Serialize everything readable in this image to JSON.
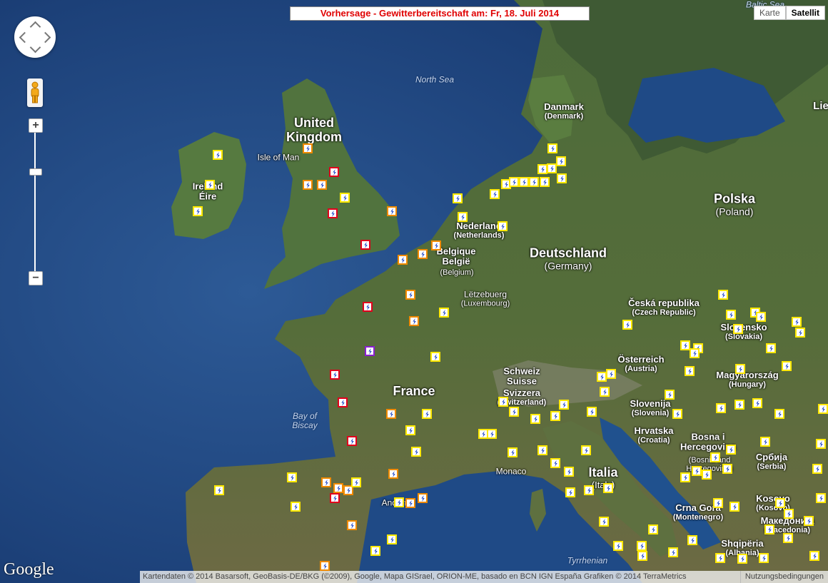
{
  "title": "Vorhersage - Gewitterbereitschaft am: Fr, 18. Juli 2014",
  "map_type": {
    "map": "Karte",
    "satellite": "Satellit",
    "active": "satellite"
  },
  "zoom": {
    "plus": "+",
    "minus": "−",
    "level_fraction": 0.72
  },
  "attribution": "Kartendaten © 2014 Basarsoft, GeoBasis-DE/BKG (©2009), Google, Mapa GISrael, ORION-ME, basado en BCN IGN España Grafiken © 2014 TerraMetrics",
  "terms": "Nutzungsbedingungen",
  "logo": "Google",
  "colors": {
    "yellow": "#ffe800",
    "orange": "#f08a00",
    "red": "#e0001c",
    "purple": "#8a1fd0",
    "title_text": "#e00000"
  },
  "countries": [
    {
      "name": "United Kingdom"
    },
    {
      "name": "Ireland",
      "sub": "Éire"
    },
    {
      "name": "Danmark",
      "sub": "(Denmark)"
    },
    {
      "name": "Polska",
      "sub": "(Poland)"
    },
    {
      "name": "Deutschland",
      "sub": "(Germany)"
    },
    {
      "name": "Nederland",
      "sub": "(Netherlands)"
    },
    {
      "name": "Belgique",
      "sub": "België"
    },
    {
      "name": "(Belgium)"
    },
    {
      "name": "Lëtzebuerg",
      "sub": "(Luxembourg)"
    },
    {
      "name": "France"
    },
    {
      "name": "Schweiz",
      "sub": "Suisse"
    },
    {
      "name": "Svizzera",
      "sub": "(Switzerland)"
    },
    {
      "name": "Česká republika",
      "sub": "(Czech Republic)"
    },
    {
      "name": "Slovensko",
      "sub": "(Slovakia)"
    },
    {
      "name": "Österreich",
      "sub": "(Austria)"
    },
    {
      "name": "Magyarország",
      "sub": "(Hungary)"
    },
    {
      "name": "Slovenija",
      "sub": "(Slovenia)"
    },
    {
      "name": "Hrvatska",
      "sub": "(Croatia)"
    },
    {
      "name": "Bosna i",
      "sub": "Hercegovina"
    },
    {
      "name": "(Bosnia and",
      "sub": "Herzegovina)"
    },
    {
      "name": "Србија",
      "sub": "(Serbia)"
    },
    {
      "name": "Italia",
      "sub": "(Italy)"
    },
    {
      "name": "Crna Gora",
      "sub": "(Montenegro)"
    },
    {
      "name": "Kosovo",
      "sub": "(Kosovo)"
    },
    {
      "name": "Македонија",
      "sub": "(Macedonia)"
    },
    {
      "name": "Shqipëria",
      "sub": "(Albania)"
    },
    {
      "name": "Lie"
    },
    {
      "name": "Isle of Man"
    },
    {
      "name": "Monaco"
    },
    {
      "name": "Andorra"
    }
  ],
  "seas": [
    {
      "name": "North Sea"
    },
    {
      "name": "Baltic Sea"
    },
    {
      "name": "Bay of",
      "sub": "Biscay"
    },
    {
      "name": "Tyrrhenian"
    }
  ],
  "markers": [
    [
      "y",
      305,
      217
    ],
    [
      "o",
      431,
      208
    ],
    [
      "y",
      294,
      259
    ],
    [
      "y",
      277,
      296
    ],
    [
      "r",
      468,
      241
    ],
    [
      "o",
      431,
      259
    ],
    [
      "o",
      451,
      259
    ],
    [
      "y",
      483,
      277
    ],
    [
      "r",
      466,
      299
    ],
    [
      "o",
      549,
      296
    ],
    [
      "r",
      512,
      343
    ],
    [
      "o",
      564,
      364
    ],
    [
      "o",
      592,
      356
    ],
    [
      "o",
      611,
      344
    ],
    [
      "y",
      641,
      278
    ],
    [
      "y",
      648,
      304
    ],
    [
      "y",
      704,
      317
    ],
    [
      "y",
      693,
      272
    ],
    [
      "y",
      709,
      258
    ],
    [
      "y",
      720,
      255
    ],
    [
      "y",
      734,
      255
    ],
    [
      "y",
      748,
      255
    ],
    [
      "y",
      763,
      255
    ],
    [
      "y",
      787,
      250
    ],
    [
      "y",
      760,
      237
    ],
    [
      "y",
      773,
      236
    ],
    [
      "y",
      786,
      226
    ],
    [
      "y",
      774,
      208
    ],
    [
      "o",
      575,
      413
    ],
    [
      "o",
      580,
      450
    ],
    [
      "y",
      622,
      438
    ],
    [
      "r",
      515,
      430
    ],
    [
      "p",
      518,
      492
    ],
    [
      "y",
      610,
      500
    ],
    [
      "r",
      469,
      525
    ],
    [
      "r",
      480,
      564
    ],
    [
      "o",
      548,
      580
    ],
    [
      "y",
      598,
      580
    ],
    [
      "y",
      575,
      603
    ],
    [
      "y",
      677,
      608
    ],
    [
      "y",
      689,
      608
    ],
    [
      "y",
      583,
      633
    ],
    [
      "r",
      493,
      618
    ],
    [
      "o",
      551,
      664
    ],
    [
      "y",
      409,
      669
    ],
    [
      "o",
      457,
      676
    ],
    [
      "o",
      474,
      684
    ],
    [
      "o",
      488,
      687
    ],
    [
      "y",
      499,
      676
    ],
    [
      "r",
      469,
      698
    ],
    [
      "y",
      559,
      704
    ],
    [
      "o",
      575,
      705
    ],
    [
      "o",
      592,
      698
    ],
    [
      "y",
      307,
      687
    ],
    [
      "y",
      414,
      710
    ],
    [
      "o",
      493,
      736
    ],
    [
      "y",
      549,
      756
    ],
    [
      "y",
      526,
      772
    ],
    [
      "o",
      455,
      793
    ],
    [
      "y",
      718,
      634
    ],
    [
      "y",
      760,
      631
    ],
    [
      "y",
      778,
      649
    ],
    [
      "y",
      797,
      661
    ],
    [
      "y",
      821,
      631
    ],
    [
      "y",
      799,
      690
    ],
    [
      "y",
      825,
      687
    ],
    [
      "y",
      852,
      684
    ],
    [
      "y",
      846,
      731
    ],
    [
      "y",
      866,
      765
    ],
    [
      "y",
      899,
      765
    ],
    [
      "y",
      900,
      779
    ],
    [
      "y",
      915,
      742
    ],
    [
      "y",
      943,
      774
    ],
    [
      "y",
      970,
      757
    ],
    [
      "y",
      1009,
      782
    ],
    [
      "y",
      1040,
      783
    ],
    [
      "y",
      1070,
      782
    ],
    [
      "y",
      1078,
      742
    ],
    [
      "y",
      1105,
      720
    ],
    [
      "y",
      1104,
      754
    ],
    [
      "y",
      1133,
      730
    ],
    [
      "y",
      1141,
      779
    ],
    [
      "y",
      1150,
      698
    ],
    [
      "y",
      1145,
      657
    ],
    [
      "y",
      1150,
      622
    ],
    [
      "y",
      1153,
      573
    ],
    [
      "y",
      1093,
      705
    ],
    [
      "y",
      1029,
      710
    ],
    [
      "y",
      1006,
      705
    ],
    [
      "y",
      990,
      665
    ],
    [
      "y",
      976,
      660
    ],
    [
      "y",
      960,
      669
    ],
    [
      "y",
      1002,
      641
    ],
    [
      "y",
      1024,
      630
    ],
    [
      "y",
      1019,
      657
    ],
    [
      "y",
      1072,
      619
    ],
    [
      "y",
      1061,
      565
    ],
    [
      "y",
      1092,
      580
    ],
    [
      "y",
      1036,
      567
    ],
    [
      "y",
      1010,
      572
    ],
    [
      "y",
      949,
      580
    ],
    [
      "y",
      938,
      553
    ],
    [
      "y",
      966,
      520
    ],
    [
      "y",
      960,
      484
    ],
    [
      "y",
      978,
      488
    ],
    [
      "y",
      973,
      495
    ],
    [
      "y",
      1013,
      413
    ],
    [
      "y",
      1024,
      441
    ],
    [
      "y",
      1034,
      461
    ],
    [
      "y",
      1058,
      438
    ],
    [
      "y",
      1066,
      444
    ],
    [
      "y",
      1116,
      451
    ],
    [
      "y",
      1121,
      466
    ],
    [
      "y",
      1080,
      488
    ],
    [
      "y",
      1102,
      513
    ],
    [
      "y",
      1037,
      517
    ],
    [
      "y",
      879,
      455
    ],
    [
      "y",
      843,
      528
    ],
    [
      "y",
      856,
      524
    ],
    [
      "y",
      847,
      549
    ],
    [
      "y",
      829,
      577
    ],
    [
      "y",
      790,
      567
    ],
    [
      "y",
      778,
      583
    ],
    [
      "y",
      750,
      587
    ],
    [
      "y",
      720,
      577
    ],
    [
      "y",
      705,
      563
    ]
  ]
}
